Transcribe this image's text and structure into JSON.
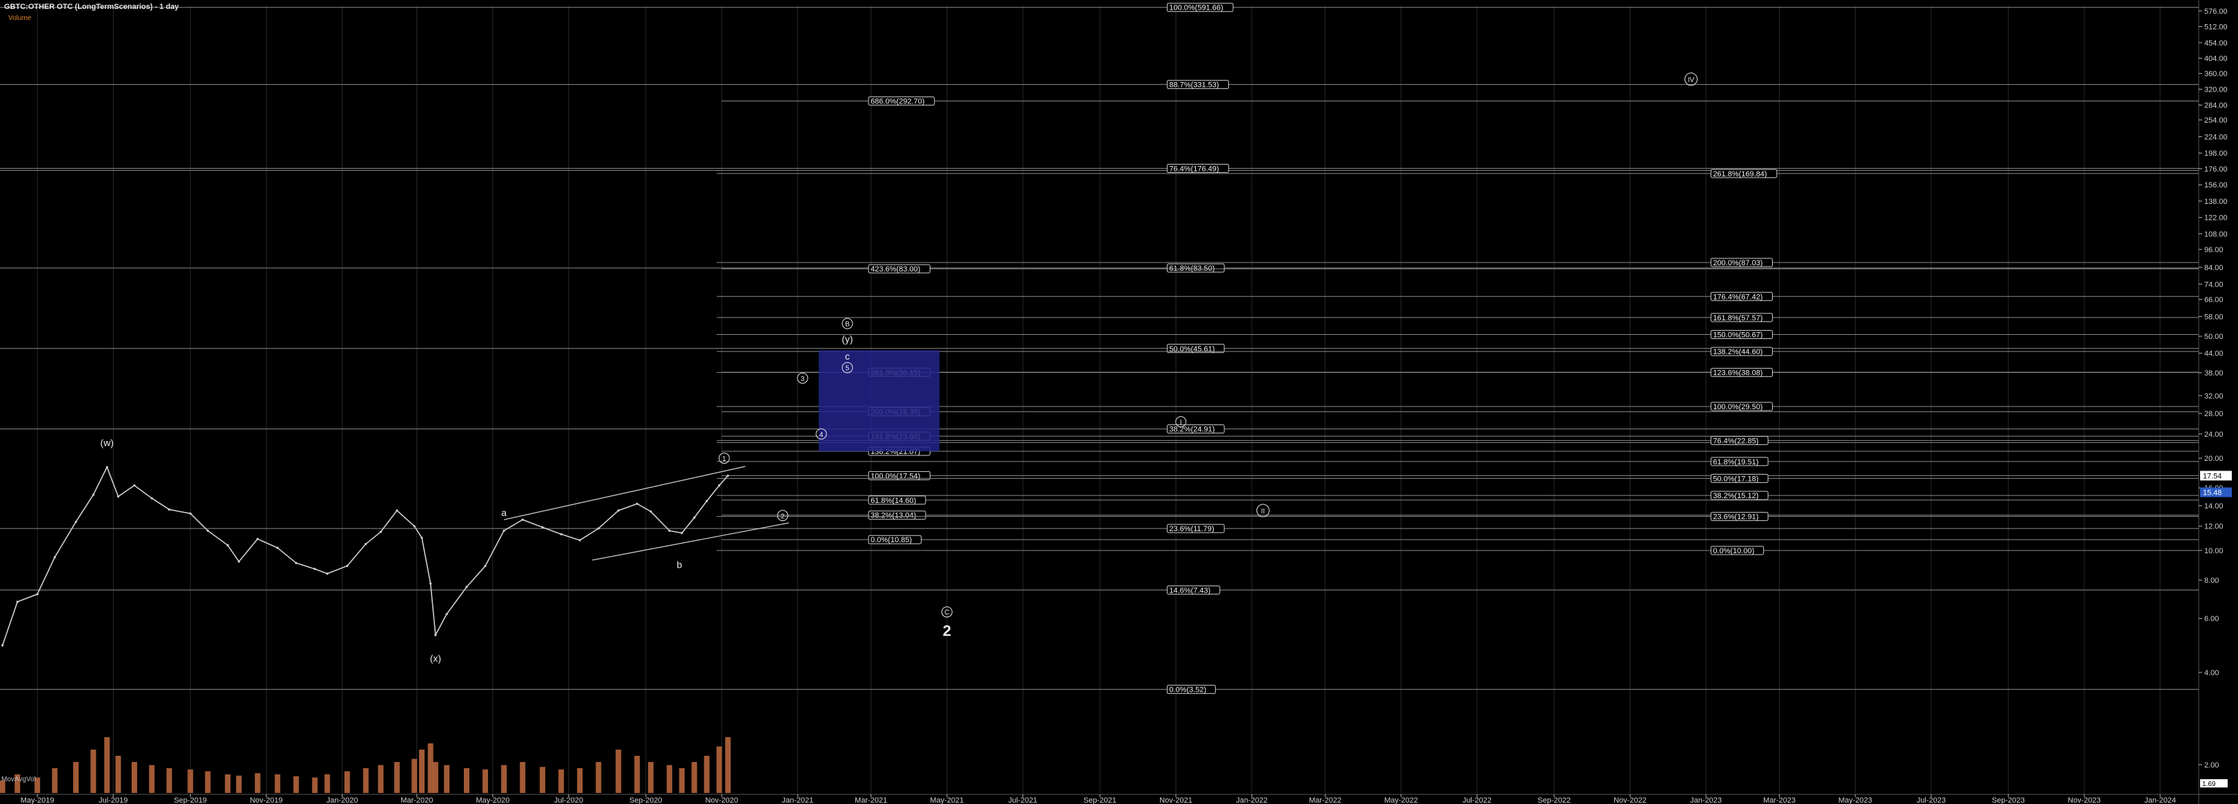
{
  "header": {
    "title": "GBTC:OTHER OTC (LongTermScenarios) - 1 day",
    "subtitle": "Volume",
    "indicator": "MovAvgVol"
  },
  "colors": {
    "background": "#000000",
    "grid": "#2a2a2a",
    "level_line": "#8c8c8c",
    "price": "#d0d0d0",
    "volume": "#b4643c",
    "target_box": "#23238c",
    "current_price_bg": "#ffffff",
    "prev_price_bg": "#2b5cc4"
  },
  "chart_data": {
    "type": "line",
    "scale": "log",
    "ylim": [
      1.6,
      600
    ],
    "xlim": [
      "2019-04-01",
      "2024-02-01"
    ],
    "y_ticks": [
      "576.00",
      "512.00",
      "454.00",
      "404.00",
      "360.00",
      "320.00",
      "284.00",
      "254.00",
      "224.00",
      "198.00",
      "176.00",
      "156.00",
      "138.00",
      "122.00",
      "108.00",
      "96.00",
      "84.00",
      "74.00",
      "66.00",
      "58.00",
      "50.00",
      "44.00",
      "38.00",
      "32.00",
      "28.00",
      "24.00",
      "20.00",
      "16.00",
      "14.00",
      "12.00",
      "10.00",
      "8.00",
      "6.00",
      "4.00",
      "2.00"
    ],
    "y_tick_values": [
      576,
      512,
      454,
      404,
      360,
      320,
      284,
      254,
      224,
      198,
      176,
      156,
      138,
      122,
      108,
      96,
      84,
      74,
      66,
      58,
      50,
      44,
      38,
      32,
      28,
      24,
      20,
      16,
      14,
      12,
      10,
      8,
      6,
      4,
      2
    ],
    "x_ticks": [
      "May-2019",
      "Jul-2019",
      "Sep-2019",
      "Nov-2019",
      "Jan-2020",
      "Mar-2020",
      "May-2020",
      "Jul-2020",
      "Sep-2020",
      "Nov-2020",
      "Jan-2021",
      "Mar-2021",
      "May-2021",
      "Jul-2021",
      "Sep-2021",
      "Nov-2021",
      "Jan-2022",
      "Mar-2022",
      "May-2022",
      "Jul-2022",
      "Sep-2022",
      "Nov-2022",
      "Jan-2023",
      "Mar-2023",
      "May-2023",
      "Jul-2023",
      "Sep-2023",
      "Nov-2023",
      "Jan-2024"
    ],
    "x_tick_dates": [
      "2019-05-01",
      "2019-07-01",
      "2019-09-01",
      "2019-11-01",
      "2020-01-01",
      "2020-03-01",
      "2020-05-01",
      "2020-07-01",
      "2020-09-01",
      "2020-11-01",
      "2021-01-01",
      "2021-03-01",
      "2021-05-01",
      "2021-07-01",
      "2021-09-01",
      "2021-11-01",
      "2022-01-01",
      "2022-03-01",
      "2022-05-01",
      "2022-07-01",
      "2022-09-01",
      "2022-11-01",
      "2023-01-01",
      "2023-03-01",
      "2023-05-01",
      "2023-07-01",
      "2023-09-01",
      "2023-11-01",
      "2024-01-01"
    ],
    "price_series": {
      "x": [
        "2019-04-03",
        "2019-04-15",
        "2019-05-01",
        "2019-05-15",
        "2019-06-01",
        "2019-06-15",
        "2019-06-26",
        "2019-07-05",
        "2019-07-18",
        "2019-08-01",
        "2019-08-15",
        "2019-09-01",
        "2019-09-15",
        "2019-10-01",
        "2019-10-10",
        "2019-10-25",
        "2019-11-10",
        "2019-11-25",
        "2019-12-10",
        "2019-12-20",
        "2020-01-05",
        "2020-01-20",
        "2020-02-01",
        "2020-02-14",
        "2020-02-28",
        "2020-03-05",
        "2020-03-12",
        "2020-03-16",
        "2020-03-25",
        "2020-04-10",
        "2020-04-25",
        "2020-05-10",
        "2020-05-25",
        "2020-06-10",
        "2020-06-25",
        "2020-07-10",
        "2020-07-25",
        "2020-08-10",
        "2020-08-25",
        "2020-09-05",
        "2020-09-20",
        "2020-09-30",
        "2020-10-10",
        "2020-10-20",
        "2020-10-30",
        "2020-11-06"
      ],
      "y": [
        4.9,
        6.8,
        7.2,
        9.5,
        12.4,
        15.2,
        18.7,
        15.0,
        16.3,
        14.8,
        13.6,
        13.2,
        11.6,
        10.4,
        9.2,
        10.9,
        10.2,
        9.1,
        8.7,
        8.4,
        8.9,
        10.5,
        11.5,
        13.5,
        12.0,
        11.0,
        7.8,
        5.3,
        6.2,
        7.6,
        8.9,
        11.6,
        12.6,
        11.9,
        11.3,
        10.8,
        11.8,
        13.5,
        14.2,
        13.4,
        11.6,
        11.4,
        12.8,
        14.5,
        16.3,
        17.54
      ]
    },
    "volume_series": {
      "note": "relative volume bars",
      "values": [
        0.2,
        0.3,
        0.25,
        0.4,
        0.5,
        0.7,
        0.9,
        0.6,
        0.5,
        0.45,
        0.4,
        0.38,
        0.35,
        0.3,
        0.28,
        0.32,
        0.3,
        0.27,
        0.25,
        0.3,
        0.35,
        0.4,
        0.45,
        0.5,
        0.55,
        0.7,
        0.8,
        0.5,
        0.45,
        0.4,
        0.38,
        0.45,
        0.5,
        0.42,
        0.38,
        0.4,
        0.5,
        0.7,
        0.6,
        0.5,
        0.45,
        0.4,
        0.5,
        0.6,
        0.75,
        0.9
      ]
    },
    "current_price": {
      "value": 17.54,
      "label": "17.54"
    },
    "prev_price": {
      "value": 15.48,
      "label": "15.48"
    },
    "min_tick_label": "1.69",
    "horizontal_levels": [
      {
        "value": 591.66,
        "label": "100.0%(591.66)",
        "x_start": "2019-04-01",
        "label_date": "2021-10-25"
      },
      {
        "value": 331.53,
        "label": "88.7%(331.53)",
        "x_start": "2019-04-01",
        "label_date": "2021-10-25"
      },
      {
        "value": 292.7,
        "label": "686.0%(292.70)",
        "x_start": "2020-11-01",
        "label_date": "2021-02-27"
      },
      {
        "value": 176.49,
        "label": "76.4%(176.49)",
        "x_start": "2019-04-01",
        "label_date": "2021-10-25",
        "double": true
      },
      {
        "value": 169.84,
        "label": "261.8%(169.84)",
        "x_start": "2020-10-28",
        "label_date": "2023-01-05"
      },
      {
        "value": 87.03,
        "label": "200.0%(87.03)",
        "x_start": "2020-10-28",
        "label_date": "2023-01-05"
      },
      {
        "value": 83.5,
        "label": "61.8%(83.50)",
        "x_start": "2019-04-01",
        "label_date": "2021-10-25"
      },
      {
        "value": 83.0,
        "label": "423.6%(83.00)",
        "x_start": "2020-11-01",
        "label_date": "2021-02-27"
      },
      {
        "value": 67.42,
        "label": "176.4%(67.42)",
        "x_start": "2020-10-28",
        "label_date": "2023-01-05"
      },
      {
        "value": 57.57,
        "label": "161.8%(57.57)",
        "x_start": "2020-10-28",
        "label_date": "2023-01-05"
      },
      {
        "value": 50.67,
        "label": "150.0%(50.67)",
        "x_start": "2020-10-28",
        "label_date": "2023-01-05"
      },
      {
        "value": 45.61,
        "label": "50.0%(45.61)",
        "x_start": "2019-04-01",
        "label_date": "2021-10-25"
      },
      {
        "value": 44.6,
        "label": "138.2%(44.60)",
        "x_start": "2020-10-28",
        "label_date": "2023-01-05"
      },
      {
        "value": 38.15,
        "label": "261.8%(38.15)",
        "x_start": "2020-11-01",
        "label_date": "2021-02-27"
      },
      {
        "value": 38.08,
        "label": "123.6%(38.08)",
        "x_start": "2020-10-28",
        "label_date": "2023-01-05"
      },
      {
        "value": 29.5,
        "label": "100.0%(29.50)",
        "x_start": "2020-10-28",
        "label_date": "2023-01-05"
      },
      {
        "value": 28.35,
        "label": "200.0%(28.35)",
        "x_start": "2020-11-01",
        "label_date": "2021-02-27"
      },
      {
        "value": 24.91,
        "label": "38.2%(24.91)",
        "x_start": "2019-04-01",
        "label_date": "2021-10-25"
      },
      {
        "value": 23.6,
        "label": "161.8%(23.60)",
        "x_start": "2020-11-01",
        "label_date": "2021-02-27"
      },
      {
        "value": 22.85,
        "label": "76.4%(22.85)",
        "x_start": "2020-10-28",
        "label_date": "2023-01-05",
        "double": true
      },
      {
        "value": 21.07,
        "label": "138.2%(21.07)",
        "x_start": "2020-11-01",
        "label_date": "2021-02-27"
      },
      {
        "value": 19.51,
        "label": "61.8%(19.51)",
        "x_start": "2020-10-28",
        "label_date": "2023-01-05"
      },
      {
        "value": 17.54,
        "label": "100.0%(17.54)",
        "x_start": "2020-11-01",
        "label_date": "2021-02-27"
      },
      {
        "value": 17.18,
        "label": "50.0%(17.18)",
        "x_start": "2020-10-28",
        "label_date": "2023-01-05"
      },
      {
        "value": 15.12,
        "label": "38.2%(15.12)",
        "x_start": "2020-10-28",
        "label_date": "2023-01-05"
      },
      {
        "value": 14.6,
        "label": "61.8%(14.60)",
        "x_start": "2020-11-01",
        "label_date": "2021-02-27"
      },
      {
        "value": 13.04,
        "label": "38.2%(13.04)",
        "x_start": "2020-11-01",
        "label_date": "2021-02-27"
      },
      {
        "value": 12.91,
        "label": "23.6%(12.91)",
        "x_start": "2020-10-28",
        "label_date": "2023-01-05"
      },
      {
        "value": 11.79,
        "label": "23.6%(11.79)",
        "x_start": "2019-04-01",
        "label_date": "2021-10-25"
      },
      {
        "value": 10.85,
        "label": "0.0%(10.85)",
        "x_start": "2020-11-01",
        "label_date": "2021-02-27"
      },
      {
        "value": 10.0,
        "label": "0.0%(10.00)",
        "x_start": "2020-10-28",
        "label_date": "2023-01-05"
      },
      {
        "value": 7.43,
        "label": "14.6%(7.43)",
        "x_start": "2019-04-01",
        "label_date": "2021-10-25"
      },
      {
        "value": 3.52,
        "label": "0.0%(3.52)",
        "x_start": "2019-04-01",
        "label_date": "2021-10-25"
      }
    ],
    "target_box": {
      "x_from": "2021-01-18",
      "x_to": "2021-04-25",
      "y_from": 21.07,
      "y_to": 45.0
    },
    "wave_labels": [
      {
        "text": "(w)",
        "date": "2019-06-26",
        "value": 22.5
      },
      {
        "text": "(x)",
        "date": "2020-03-16",
        "value": 4.45
      },
      {
        "text": "a",
        "date": "2020-05-10",
        "value": 13.3
      },
      {
        "text": "b",
        "date": "2020-09-28",
        "value": 9.0
      },
      {
        "text": "1",
        "date": "2020-11-03",
        "value": 20.0,
        "circle": true
      },
      {
        "text": "2",
        "date": "2020-12-20",
        "value": 13.0,
        "circle": true
      },
      {
        "text": "3",
        "date": "2021-01-05",
        "value": 36.5,
        "circle": true
      },
      {
        "text": "4",
        "date": "2021-01-20",
        "value": 24.0,
        "circle": true
      },
      {
        "text": "5",
        "date": "2021-02-10",
        "value": 39.5,
        "circle": true
      },
      {
        "text": "c",
        "date": "2021-02-10",
        "value": 43.0
      },
      {
        "text": "(y)",
        "date": "2021-02-10",
        "value": 49.0
      },
      {
        "text": "B",
        "date": "2021-02-10",
        "value": 55.0,
        "circle": true
      },
      {
        "text": "C",
        "date": "2021-05-01",
        "value": 6.3,
        "circle": true
      },
      {
        "text": "2",
        "date": "2021-05-01",
        "value": 5.4,
        "bold": true
      },
      {
        "text": "I",
        "date": "2021-11-05",
        "value": 26.3,
        "circle": true
      },
      {
        "text": "II",
        "date": "2022-01-10",
        "value": 13.5,
        "circle": true
      },
      {
        "text": "IV",
        "date": "2022-12-20",
        "value": 345.0,
        "circle": true
      }
    ],
    "trend_channel": [
      {
        "from_date": "2020-05-10",
        "from_value": 12.6,
        "to_date": "2020-11-20",
        "to_value": 18.8
      },
      {
        "from_date": "2020-07-20",
        "from_value": 9.3,
        "to_date": "2020-12-25",
        "to_value": 12.3
      }
    ]
  }
}
